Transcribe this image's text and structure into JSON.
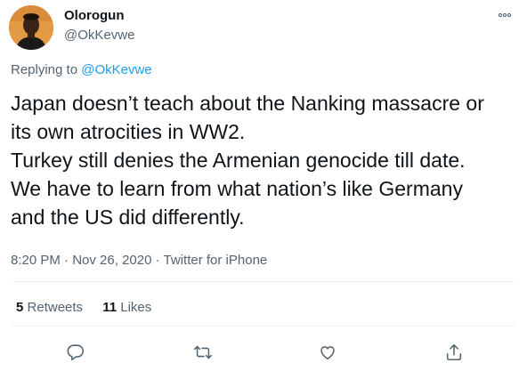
{
  "tweet": {
    "author": {
      "display_name": "Olorogun",
      "handle": "@OkKevwe"
    },
    "reply_context": {
      "prefix": "Replying to",
      "mention": "@OkKevwe"
    },
    "text_lines": [
      "Japan doesn’t teach about the Nanking massacre or",
      "its own atrocities in WW2.",
      "Turkey still denies the Armenian genocide till date.",
      "We have to learn from what nation’s like Germany",
      "and the US did differently."
    ],
    "meta": {
      "time": "8:20 PM",
      "separator": "·",
      "date": "Nov 26, 2020",
      "source": "Twitter for iPhone"
    },
    "stats": {
      "retweets_count": "5",
      "retweets_label": "Retweets",
      "likes_count": "11",
      "likes_label": "Likes"
    },
    "icons": {
      "more": "more-horizontal-icon",
      "reply": "reply-icon",
      "retweet": "retweet-icon",
      "like": "heart-icon",
      "share": "share-icon"
    }
  }
}
